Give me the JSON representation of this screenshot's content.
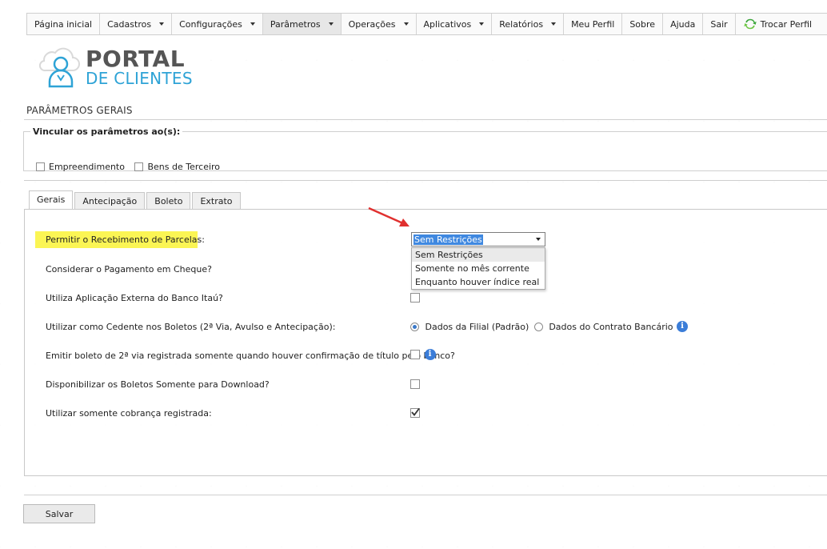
{
  "nav": {
    "items": [
      {
        "label": "Página inicial",
        "caret": false
      },
      {
        "label": "Cadastros",
        "caret": true
      },
      {
        "label": "Configurações",
        "caret": true
      },
      {
        "label": "Parâmetros",
        "caret": true,
        "active": true
      },
      {
        "label": "Operações",
        "caret": true
      },
      {
        "label": "Aplicativos",
        "caret": true
      },
      {
        "label": "Relatórios",
        "caret": true
      },
      {
        "label": "Meu Perfil",
        "caret": false
      },
      {
        "label": "Sobre",
        "caret": false
      },
      {
        "label": "Ajuda",
        "caret": false
      },
      {
        "label": "Sair",
        "caret": false
      }
    ],
    "switch_profile": "Trocar Perfil"
  },
  "logo": {
    "title": "PORTAL",
    "subtitle": "DE CLIENTES",
    "accent_color": "#2ea3d6"
  },
  "section_title": "PARÂMETROS GERAIS",
  "vincular": {
    "legend": "Vincular os parâmetros ao(s):",
    "options": [
      {
        "label": "Empreendimento",
        "checked": false
      },
      {
        "label": "Bens de Terceiro",
        "checked": false
      }
    ]
  },
  "tabs": [
    {
      "label": "Gerais",
      "active": true
    },
    {
      "label": "Antecipação",
      "active": false
    },
    {
      "label": "Boleto",
      "active": false
    },
    {
      "label": "Extrato",
      "active": false
    }
  ],
  "fields": {
    "recebimento": {
      "label": "Permitir o Recebimento de Parcelas:",
      "selected": "Sem Restrições",
      "options": [
        "Sem Restrições",
        "Somente no mês corrente",
        "Enquanto houver índice real"
      ]
    },
    "cheque": {
      "label": "Considerar o Pagamento em Cheque?"
    },
    "itau": {
      "label": "Utiliza Aplicação Externa do Banco Itaú?",
      "checked": false
    },
    "cedente": {
      "label": "Utilizar como Cedente nos Boletos (2ª Via, Avulso e Antecipação):",
      "options": [
        {
          "label": "Dados da Filial (Padrão)",
          "selected": true
        },
        {
          "label": "Dados do Contrato Bancário",
          "selected": false
        }
      ]
    },
    "boleto_registrada": {
      "label": "Emitir boleto de 2ª via registrada somente quando houver confirmação de título pelo banco?",
      "checked": false
    },
    "download": {
      "label": "Disponibilizar os Boletos Somente para Download?",
      "checked": false
    },
    "cobranca": {
      "label": "Utilizar somente cobrança registrada:",
      "checked": true
    }
  },
  "save_label": "Salvar",
  "colors": {
    "highlight": "#fbf554",
    "select_blue": "#3f88e0",
    "info_blue": "#3b7dd8",
    "arrow": "#e0302f"
  }
}
